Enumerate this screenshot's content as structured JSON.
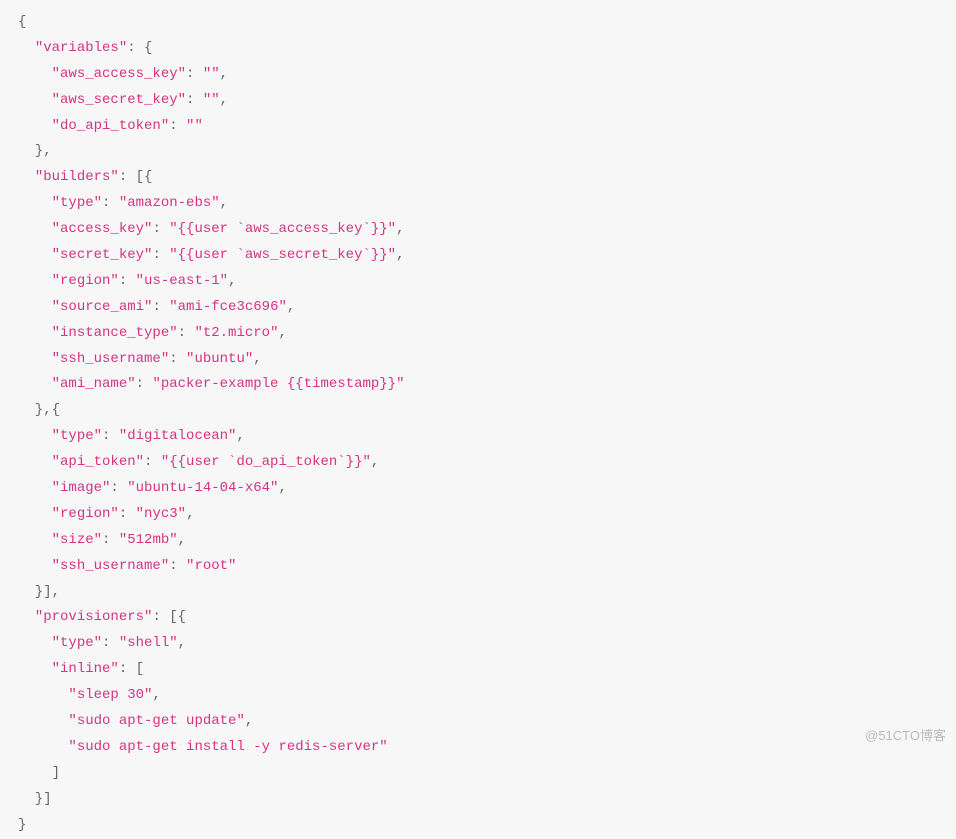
{
  "lines": [
    [
      {
        "t": "{",
        "c": "punct"
      }
    ],
    [
      {
        "t": "  ",
        "c": "punct"
      },
      {
        "t": "\"variables\"",
        "c": "key"
      },
      {
        "t": ": {",
        "c": "punct"
      }
    ],
    [
      {
        "t": "    ",
        "c": "punct"
      },
      {
        "t": "\"aws_access_key\"",
        "c": "key"
      },
      {
        "t": ": ",
        "c": "punct"
      },
      {
        "t": "\"\"",
        "c": "str"
      },
      {
        "t": ",",
        "c": "punct"
      }
    ],
    [
      {
        "t": "    ",
        "c": "punct"
      },
      {
        "t": "\"aws_secret_key\"",
        "c": "key"
      },
      {
        "t": ": ",
        "c": "punct"
      },
      {
        "t": "\"\"",
        "c": "str"
      },
      {
        "t": ",",
        "c": "punct"
      }
    ],
    [
      {
        "t": "    ",
        "c": "punct"
      },
      {
        "t": "\"do_api_token\"",
        "c": "key"
      },
      {
        "t": ": ",
        "c": "punct"
      },
      {
        "t": "\"\"",
        "c": "str"
      }
    ],
    [
      {
        "t": "  },",
        "c": "punct"
      }
    ],
    [
      {
        "t": "  ",
        "c": "punct"
      },
      {
        "t": "\"builders\"",
        "c": "key"
      },
      {
        "t": ": [{",
        "c": "punct"
      }
    ],
    [
      {
        "t": "    ",
        "c": "punct"
      },
      {
        "t": "\"type\"",
        "c": "key"
      },
      {
        "t": ": ",
        "c": "punct"
      },
      {
        "t": "\"amazon-ebs\"",
        "c": "str"
      },
      {
        "t": ",",
        "c": "punct"
      }
    ],
    [
      {
        "t": "    ",
        "c": "punct"
      },
      {
        "t": "\"access_key\"",
        "c": "key"
      },
      {
        "t": ": ",
        "c": "punct"
      },
      {
        "t": "\"{{user `aws_access_key`}}\"",
        "c": "str"
      },
      {
        "t": ",",
        "c": "punct"
      }
    ],
    [
      {
        "t": "    ",
        "c": "punct"
      },
      {
        "t": "\"secret_key\"",
        "c": "key"
      },
      {
        "t": ": ",
        "c": "punct"
      },
      {
        "t": "\"{{user `aws_secret_key`}}\"",
        "c": "str"
      },
      {
        "t": ",",
        "c": "punct"
      }
    ],
    [
      {
        "t": "    ",
        "c": "punct"
      },
      {
        "t": "\"region\"",
        "c": "key"
      },
      {
        "t": ": ",
        "c": "punct"
      },
      {
        "t": "\"us-east-1\"",
        "c": "str"
      },
      {
        "t": ",",
        "c": "punct"
      }
    ],
    [
      {
        "t": "    ",
        "c": "punct"
      },
      {
        "t": "\"source_ami\"",
        "c": "key"
      },
      {
        "t": ": ",
        "c": "punct"
      },
      {
        "t": "\"ami-fce3c696\"",
        "c": "str"
      },
      {
        "t": ",",
        "c": "punct"
      }
    ],
    [
      {
        "t": "    ",
        "c": "punct"
      },
      {
        "t": "\"instance_type\"",
        "c": "key"
      },
      {
        "t": ": ",
        "c": "punct"
      },
      {
        "t": "\"t2.micro\"",
        "c": "str"
      },
      {
        "t": ",",
        "c": "punct"
      }
    ],
    [
      {
        "t": "    ",
        "c": "punct"
      },
      {
        "t": "\"ssh_username\"",
        "c": "key"
      },
      {
        "t": ": ",
        "c": "punct"
      },
      {
        "t": "\"ubuntu\"",
        "c": "str"
      },
      {
        "t": ",",
        "c": "punct"
      }
    ],
    [
      {
        "t": "    ",
        "c": "punct"
      },
      {
        "t": "\"ami_name\"",
        "c": "key"
      },
      {
        "t": ": ",
        "c": "punct"
      },
      {
        "t": "\"packer-example {{timestamp}}\"",
        "c": "str"
      }
    ],
    [
      {
        "t": "  },{",
        "c": "punct"
      }
    ],
    [
      {
        "t": "    ",
        "c": "punct"
      },
      {
        "t": "\"type\"",
        "c": "key"
      },
      {
        "t": ": ",
        "c": "punct"
      },
      {
        "t": "\"digitalocean\"",
        "c": "str"
      },
      {
        "t": ",",
        "c": "punct"
      }
    ],
    [
      {
        "t": "    ",
        "c": "punct"
      },
      {
        "t": "\"api_token\"",
        "c": "key"
      },
      {
        "t": ": ",
        "c": "punct"
      },
      {
        "t": "\"{{user `do_api_token`}}\"",
        "c": "str"
      },
      {
        "t": ",",
        "c": "punct"
      }
    ],
    [
      {
        "t": "    ",
        "c": "punct"
      },
      {
        "t": "\"image\"",
        "c": "key"
      },
      {
        "t": ": ",
        "c": "punct"
      },
      {
        "t": "\"ubuntu-14-04-x64\"",
        "c": "str"
      },
      {
        "t": ",",
        "c": "punct"
      }
    ],
    [
      {
        "t": "    ",
        "c": "punct"
      },
      {
        "t": "\"region\"",
        "c": "key"
      },
      {
        "t": ": ",
        "c": "punct"
      },
      {
        "t": "\"nyc3\"",
        "c": "str"
      },
      {
        "t": ",",
        "c": "punct"
      }
    ],
    [
      {
        "t": "    ",
        "c": "punct"
      },
      {
        "t": "\"size\"",
        "c": "key"
      },
      {
        "t": ": ",
        "c": "punct"
      },
      {
        "t": "\"512mb\"",
        "c": "str"
      },
      {
        "t": ",",
        "c": "punct"
      }
    ],
    [
      {
        "t": "    ",
        "c": "punct"
      },
      {
        "t": "\"ssh_username\"",
        "c": "key"
      },
      {
        "t": ": ",
        "c": "punct"
      },
      {
        "t": "\"root\"",
        "c": "str"
      }
    ],
    [
      {
        "t": "  }],",
        "c": "punct"
      }
    ],
    [
      {
        "t": "  ",
        "c": "punct"
      },
      {
        "t": "\"provisioners\"",
        "c": "key"
      },
      {
        "t": ": [{",
        "c": "punct"
      }
    ],
    [
      {
        "t": "    ",
        "c": "punct"
      },
      {
        "t": "\"type\"",
        "c": "key"
      },
      {
        "t": ": ",
        "c": "punct"
      },
      {
        "t": "\"shell\"",
        "c": "str"
      },
      {
        "t": ",",
        "c": "punct"
      }
    ],
    [
      {
        "t": "    ",
        "c": "punct"
      },
      {
        "t": "\"inline\"",
        "c": "key"
      },
      {
        "t": ": [",
        "c": "punct"
      }
    ],
    [
      {
        "t": "      ",
        "c": "punct"
      },
      {
        "t": "\"sleep 30\"",
        "c": "str"
      },
      {
        "t": ",",
        "c": "punct"
      }
    ],
    [
      {
        "t": "      ",
        "c": "punct"
      },
      {
        "t": "\"sudo apt-get update\"",
        "c": "str"
      },
      {
        "t": ",",
        "c": "punct"
      }
    ],
    [
      {
        "t": "      ",
        "c": "punct"
      },
      {
        "t": "\"sudo apt-get install -y redis-server\"",
        "c": "str"
      }
    ],
    [
      {
        "t": "    ]",
        "c": "punct"
      }
    ],
    [
      {
        "t": "  }]",
        "c": "punct"
      }
    ],
    [
      {
        "t": "}",
        "c": "punct"
      }
    ]
  ],
  "watermark": "@51CTO博客"
}
